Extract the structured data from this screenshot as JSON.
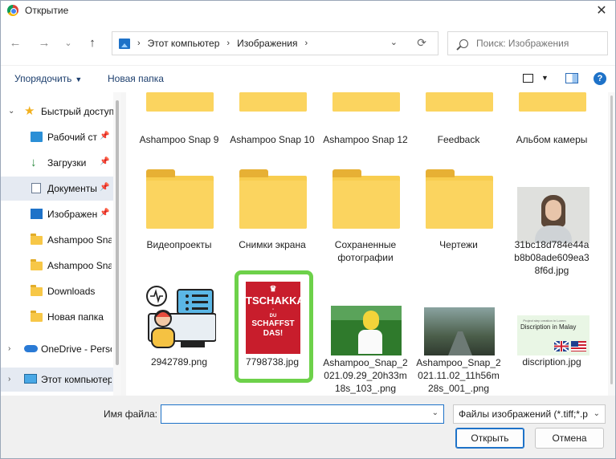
{
  "window": {
    "title": "Открытие",
    "close_glyph": "✕"
  },
  "nav": {
    "back_glyph": "←",
    "forward_glyph": "→",
    "history_glyph": "⌄",
    "up_glyph": "↑",
    "breadcrumbs": [
      "Этот компьютер",
      "Изображения"
    ],
    "crumb_sep": "›",
    "dropdown_glyph": "⌄",
    "refresh_glyph": "⟳",
    "search_placeholder": "Поиск: Изображения"
  },
  "toolbar": {
    "organize_label": "Упорядочить",
    "new_folder_label": "Новая папка",
    "caret": "▼",
    "help": "?"
  },
  "sidebar": {
    "items": [
      {
        "label": "Быстрый доступ",
        "icon": "star-icon",
        "chevron": "⌄"
      },
      {
        "label": "Рабочий стол",
        "icon": "desktop-icon",
        "pinned": "📌"
      },
      {
        "label": "Загрузки",
        "icon": "download-icon",
        "pinned": "📌"
      },
      {
        "label": "Документы",
        "icon": "documents-icon",
        "pinned": "📌"
      },
      {
        "label": "Изображения",
        "icon": "pictures-icon",
        "pinned": "📌"
      },
      {
        "label": "Ashampoo Snap",
        "icon": "folder-icon"
      },
      {
        "label": "Ashampoo Snap",
        "icon": "folder-icon"
      },
      {
        "label": "Downloads",
        "icon": "folder-icon"
      },
      {
        "label": "Новая папка",
        "icon": "folder-icon"
      },
      {
        "label": "OneDrive - Personal",
        "icon": "cloud-icon",
        "chevron": "›"
      },
      {
        "label": "Этот компьютер",
        "icon": "monitor-icon",
        "chevron": "›"
      }
    ]
  },
  "files": {
    "row1": [
      "Ashampoo Snap 9",
      "Ashampoo Snap 10",
      "Ashampoo Snap 12",
      "Feedback",
      "Альбом камеры"
    ],
    "row2": [
      "Видеопроекты",
      "Снимки экрана",
      "Сохраненные фотографии",
      "Чертежи",
      "31bc18d784e44ab8b08ade609ea38f6d.jpg"
    ],
    "row3": [
      "2942789.png",
      "7798738.jpg",
      "Ashampoo_Snap_2021.09.29_20h33m18s_103_.png",
      "Ashampoo_Snap_2021.11.02_11h56m28s_001_.png",
      "discription.jpg"
    ]
  },
  "thumbs": {
    "red_crown": "♛",
    "red_l1": "TSCHAKKA",
    "red_l2": "-\nDU",
    "red_l3": "SCHAFFST\nDAS!",
    "disc_top": "Project step creation in Lorem",
    "disc_title": "Discription in Malay"
  },
  "bottom": {
    "filename_label": "Имя файла:",
    "filename_value": "",
    "filetype_value": "Файлы изображений (*.tiff;*.p",
    "open_label": "Открыть",
    "cancel_label": "Отмена",
    "caret": "⌄"
  },
  "colors": {
    "accent": "#1e72c8",
    "highlight": "#6dd14a",
    "folder": "#f8cd4f"
  }
}
